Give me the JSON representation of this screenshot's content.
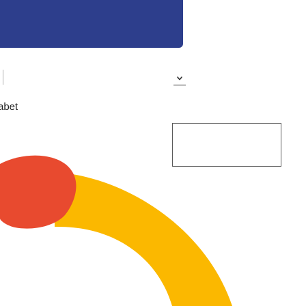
{
  "label": {
    "text": "abet"
  },
  "colors": {
    "hero": "#2d3e8c",
    "red_blob": "#e84a2f",
    "yellow_arc": "#fbb800",
    "box_border": "#5a5a5a"
  },
  "icons": {
    "dropdown": "chevron-down-icon"
  }
}
